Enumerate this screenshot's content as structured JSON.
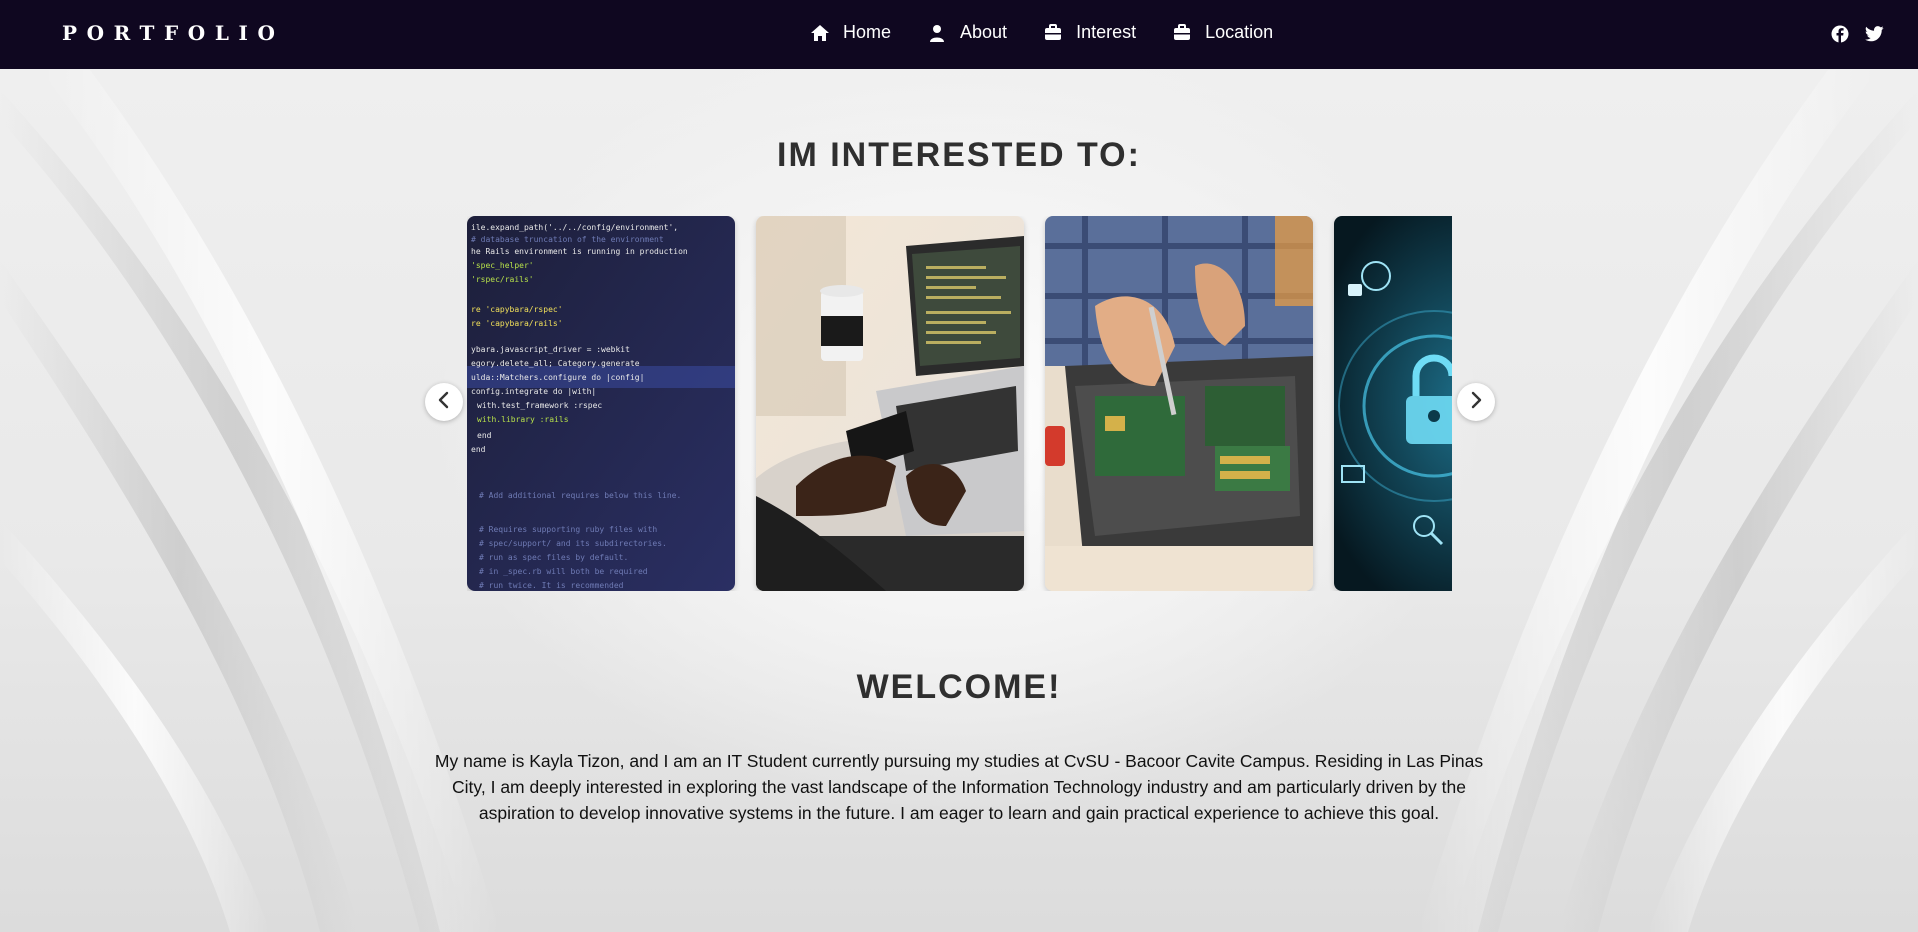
{
  "navbar": {
    "brand": "PORTFOLIO",
    "menu": [
      {
        "label": "Home",
        "icon": "home-icon"
      },
      {
        "label": "About",
        "icon": "user-icon"
      },
      {
        "label": "Interest",
        "icon": "briefcase-icon"
      },
      {
        "label": "Location",
        "icon": "briefcase-icon"
      }
    ],
    "socials": [
      "facebook-icon",
      "twitter-icon"
    ]
  },
  "interests": {
    "title": "IM INTERESTED TO:",
    "cards": [
      {
        "image": "code-on-screen"
      },
      {
        "image": "laptop-with-coffee"
      },
      {
        "image": "hardware-repair"
      },
      {
        "image": "cybersecurity-lock"
      }
    ],
    "prev_icon": "chevron-left-icon",
    "next_icon": "chevron-right-icon"
  },
  "welcome": {
    "title": "WELCOME!",
    "text": "My name is Kayla Tizon, and I am an IT Student currently pursuing my studies at CvSU - Bacoor Cavite Campus. Residing in Las Pinas City, I am deeply interested in exploring the vast landscape of the Information Technology industry and am particularly driven by the aspiration to develop innovative systems in the future. I am eager to learn and gain practical experience to achieve this goal."
  },
  "colors": {
    "navbar_bg": "#0f0720",
    "heading": "#2f2f2f",
    "background": "#e6e6e6"
  }
}
